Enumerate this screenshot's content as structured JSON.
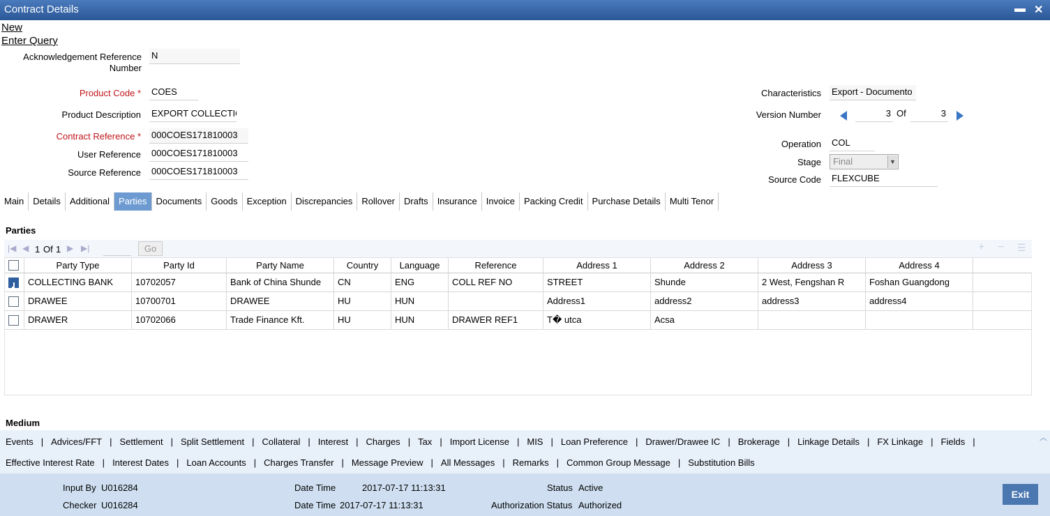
{
  "window": {
    "title": "Contract Details",
    "minimize": "▬",
    "close": "✕"
  },
  "actions": {
    "new": "New",
    "enter_query": "Enter Query"
  },
  "form": {
    "ack_ref_label": "Acknowledgement Reference Number",
    "ack_ref_value": "N",
    "product_code_label": "Product Code",
    "product_code_value": "COES",
    "product_desc_label": "Product Description",
    "product_desc_value": "EXPORT COLLECTIO",
    "contract_ref_label": "Contract Reference",
    "contract_ref_value": "000COES171810003",
    "user_ref_label": "User Reference",
    "user_ref_value": "000COES171810003",
    "source_ref_label": "Source Reference",
    "source_ref_value": "000COES171810003",
    "required_mark": "*",
    "characteristics_label": "Characteristics",
    "characteristics_value": "Export  - Documento",
    "version_label": "Version Number",
    "version_value": "3",
    "version_of": "Of",
    "version_total": "3",
    "operation_label": "Operation",
    "operation_value": "COL",
    "stage_label": "Stage",
    "stage_value": "Final",
    "source_code_label": "Source Code",
    "source_code_value": "FLEXCUBE"
  },
  "tabs": [
    "Main",
    "Details",
    "Additional",
    "Parties",
    "Documents",
    "Goods",
    "Exception",
    "Discrepancies",
    "Rollover",
    "Drafts",
    "Insurance",
    "Invoice",
    "Packing Credit",
    "Purchase Details",
    "Multi Tenor"
  ],
  "active_tab": "Parties",
  "parties": {
    "section_title": "Parties",
    "pager": {
      "current": "1",
      "of": "Of",
      "total": "1",
      "go": "Go"
    },
    "columns": [
      "Party Type",
      "Party Id",
      "Party Name",
      "Country",
      "Language",
      "Reference",
      "Address 1",
      "Address 2",
      "Address 3",
      "Address 4"
    ],
    "rows": [
      {
        "checked": true,
        "cells": [
          "COLLECTING BANK",
          "10702057",
          "Bank of China Shunde",
          "CN",
          "ENG",
          "COLL REF NO",
          "STREET",
          "Shunde",
          "2 West, Fengshan R",
          "Foshan Guangdong"
        ]
      },
      {
        "checked": false,
        "cells": [
          "DRAWEE",
          "10700701",
          "DRAWEE",
          "HU",
          "HUN",
          "",
          "Address1",
          "address2",
          "address3",
          "address4"
        ]
      },
      {
        "checked": false,
        "cells": [
          "DRAWER",
          "10702066",
          "Trade Finance Kft.",
          "HU",
          "HUN",
          "DRAWER REF1",
          "T� utca",
          "Acsa",
          "",
          ""
        ]
      }
    ]
  },
  "medium": {
    "title": "Medium",
    "line1": [
      "Events",
      "Advices/FFT",
      "Settlement",
      "Split Settlement",
      "Collateral",
      "Interest",
      "Charges",
      "Tax",
      "Import License",
      "MIS",
      "Loan Preference",
      "Drawer/Drawee IC",
      "Brokerage",
      "Linkage Details",
      "FX Linkage",
      "Fields"
    ],
    "line2": [
      "Effective Interest Rate",
      "Interest Dates",
      "Loan Accounts",
      "Charges Transfer",
      "Message Preview",
      "All Messages",
      "Remarks",
      "Common Group Message",
      "Substitution Bills"
    ]
  },
  "footer": {
    "input_by_label": "Input By",
    "input_by_value": "U016284",
    "checker_label": "Checker",
    "checker_value": "U016284",
    "dt1_label": "Date Time",
    "dt1_value": "2017-07-17 11:13:31",
    "dt2_label": "Date Time",
    "dt2_value": "2017-07-17 11:13:31",
    "status_label": "Status",
    "status_value": "Active",
    "auth_label": "Authorization Status",
    "auth_value": "Authorized",
    "exit": "Exit"
  },
  "colors": {
    "titlebar": "#2b5797",
    "active_tab": "#6d9bd1",
    "required": "#c0141a",
    "footer": "#cfdff1"
  }
}
